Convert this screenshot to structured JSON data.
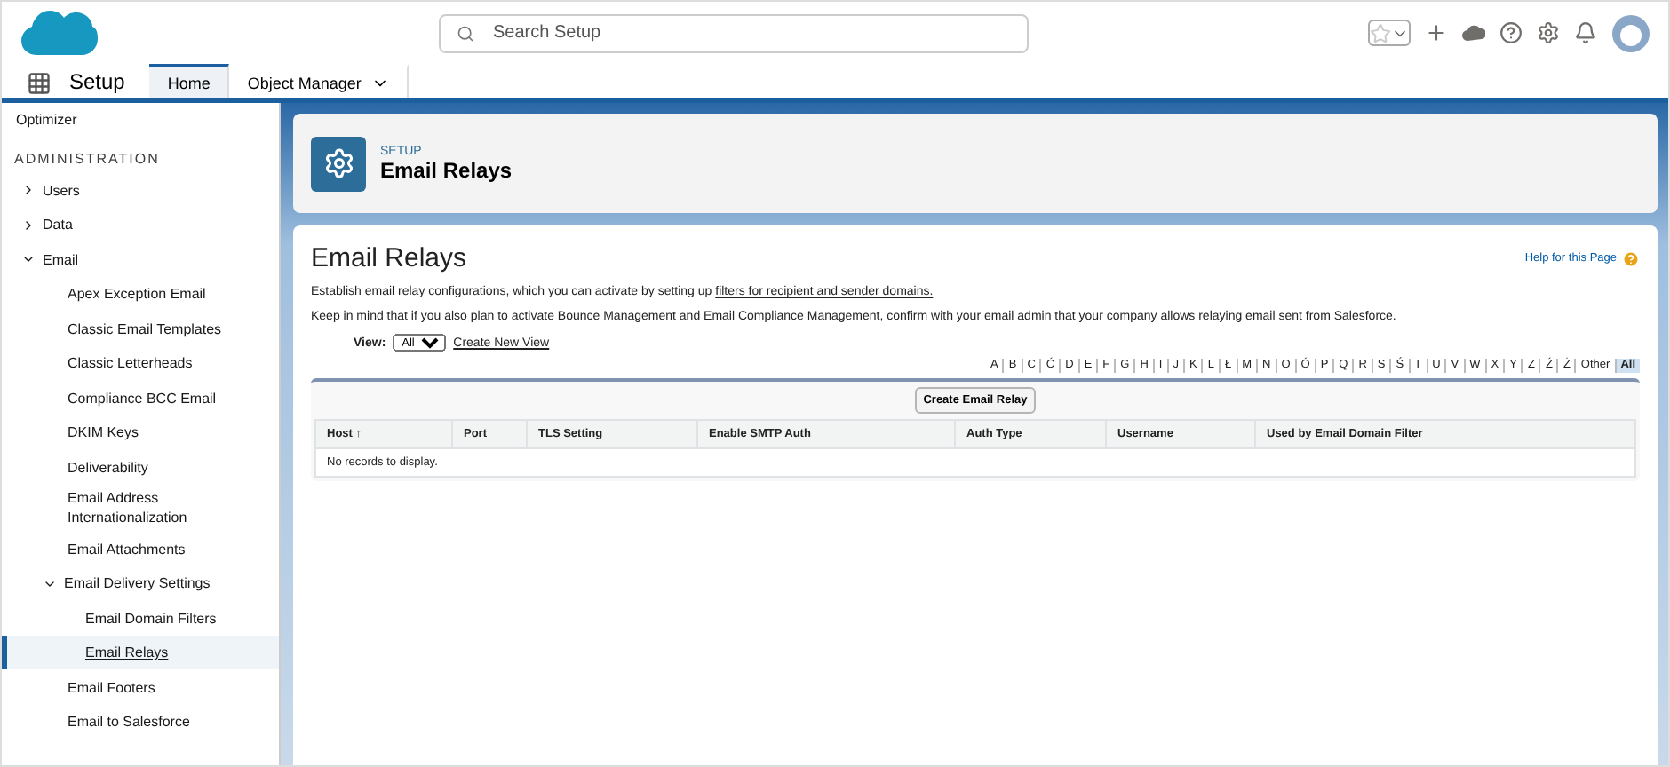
{
  "header": {
    "search": {
      "placeholder": "Search Setup"
    }
  },
  "nav": {
    "app_name": "Setup",
    "tabs": [
      {
        "label": "Home",
        "selected": true,
        "menu": false
      },
      {
        "label": "Object Manager",
        "selected": false,
        "menu": true
      }
    ]
  },
  "sidebar": {
    "top_item": "Optimizer",
    "section": "ADMINISTRATION",
    "items": [
      {
        "label": "Users",
        "expanded": false,
        "selected": false
      },
      {
        "label": "Data",
        "expanded": false,
        "selected": false
      },
      {
        "label": "Email",
        "expanded": true,
        "selected": false,
        "children": [
          {
            "label": "Apex Exception Email",
            "selected": false
          },
          {
            "label": "Classic Email Templates",
            "selected": false
          },
          {
            "label": "Classic Letterheads",
            "selected": false
          },
          {
            "label": "Compliance BCC Email",
            "selected": false
          },
          {
            "label": "DKIM Keys",
            "selected": false
          },
          {
            "label": "Deliverability",
            "selected": false
          },
          {
            "label": "Email Address Internationalization",
            "selected": false
          },
          {
            "label": "Email Attachments",
            "selected": false
          },
          {
            "label": "Email Delivery Settings",
            "expanded": true,
            "selected": false,
            "children": [
              {
                "label": "Email Domain Filters",
                "selected": false
              },
              {
                "label": "Email Relays",
                "selected": true
              }
            ]
          },
          {
            "label": "Email Footers",
            "selected": false
          },
          {
            "label": "Email to Salesforce",
            "selected": false
          }
        ]
      }
    ]
  },
  "page_header": {
    "eyebrow": "SETUP",
    "title": "Email Relays"
  },
  "content": {
    "title": "Email Relays",
    "help_link": "Help for this Page",
    "intro": "Establish email relay configurations, which you can activate by setting up ",
    "intro_link": "filters for recipient and sender domains.",
    "note": "Keep in mind that if you also plan to activate Bounce Management and Email Compliance Management, confirm with your email admin that your company allows relaying email sent from Salesforce.",
    "view_label": "View:",
    "view_value": "All",
    "create_view": "Create New View",
    "letters": [
      {
        "label": "A",
        "selected": false
      },
      {
        "label": "B",
        "selected": false
      },
      {
        "label": "C",
        "selected": false
      },
      {
        "label": "Ć",
        "selected": false
      },
      {
        "label": "D",
        "selected": false
      },
      {
        "label": "E",
        "selected": false
      },
      {
        "label": "F",
        "selected": false
      },
      {
        "label": "G",
        "selected": false
      },
      {
        "label": "H",
        "selected": false
      },
      {
        "label": "I",
        "selected": false
      },
      {
        "label": "J",
        "selected": false
      },
      {
        "label": "K",
        "selected": false
      },
      {
        "label": "L",
        "selected": false
      },
      {
        "label": "Ł",
        "selected": false
      },
      {
        "label": "M",
        "selected": false
      },
      {
        "label": "N",
        "selected": false
      },
      {
        "label": "O",
        "selected": false
      },
      {
        "label": "Ó",
        "selected": false
      },
      {
        "label": "P",
        "selected": false
      },
      {
        "label": "Q",
        "selected": false
      },
      {
        "label": "R",
        "selected": false
      },
      {
        "label": "S",
        "selected": false
      },
      {
        "label": "Ś",
        "selected": false
      },
      {
        "label": "T",
        "selected": false
      },
      {
        "label": "U",
        "selected": false
      },
      {
        "label": "V",
        "selected": false
      },
      {
        "label": "W",
        "selected": false
      },
      {
        "label": "X",
        "selected": false
      },
      {
        "label": "Y",
        "selected": false
      },
      {
        "label": "Z",
        "selected": false
      },
      {
        "label": "Ź",
        "selected": false
      },
      {
        "label": "Ż",
        "selected": false
      },
      {
        "label": "Other",
        "selected": false
      },
      {
        "label": "All",
        "selected": true
      }
    ],
    "create_button": "Create Email Relay",
    "table": {
      "columns": [
        {
          "label": "Host",
          "sort": "↑"
        },
        {
          "label": "Port"
        },
        {
          "label": "TLS Setting"
        },
        {
          "label": "Enable SMTP Auth"
        },
        {
          "label": "Auth Type"
        },
        {
          "label": "Username"
        },
        {
          "label": "Used by Email Domain Filter"
        }
      ],
      "empty": "No records to display."
    }
  }
}
